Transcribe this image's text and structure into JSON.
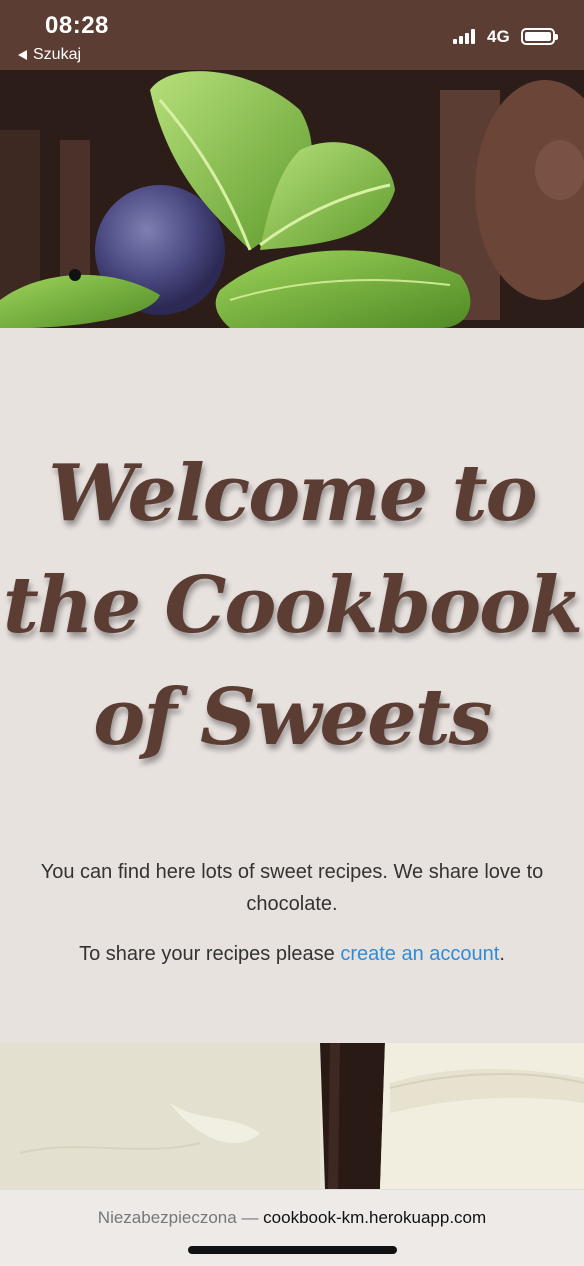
{
  "status_bar": {
    "time": "08:28",
    "back_label": "Szukaj",
    "network": "4G"
  },
  "page": {
    "title_lines": [
      "Welcome to",
      "the Cookbook",
      "of Sweets"
    ],
    "description": "You can find here lots of sweet recipes. We share love to chocolate.",
    "share_prefix": "To share your recipes please ",
    "share_link": "create an account",
    "share_suffix": "."
  },
  "browser": {
    "security_label": "Niezabezpieczona",
    "separator": " — ",
    "host": "cookbook-km.herokuapp.com"
  },
  "colors": {
    "status_bar_bg": "#5b3d33",
    "title": "#5b3d33",
    "link": "#2f8cd8",
    "page_bg": "#e8e2df"
  }
}
